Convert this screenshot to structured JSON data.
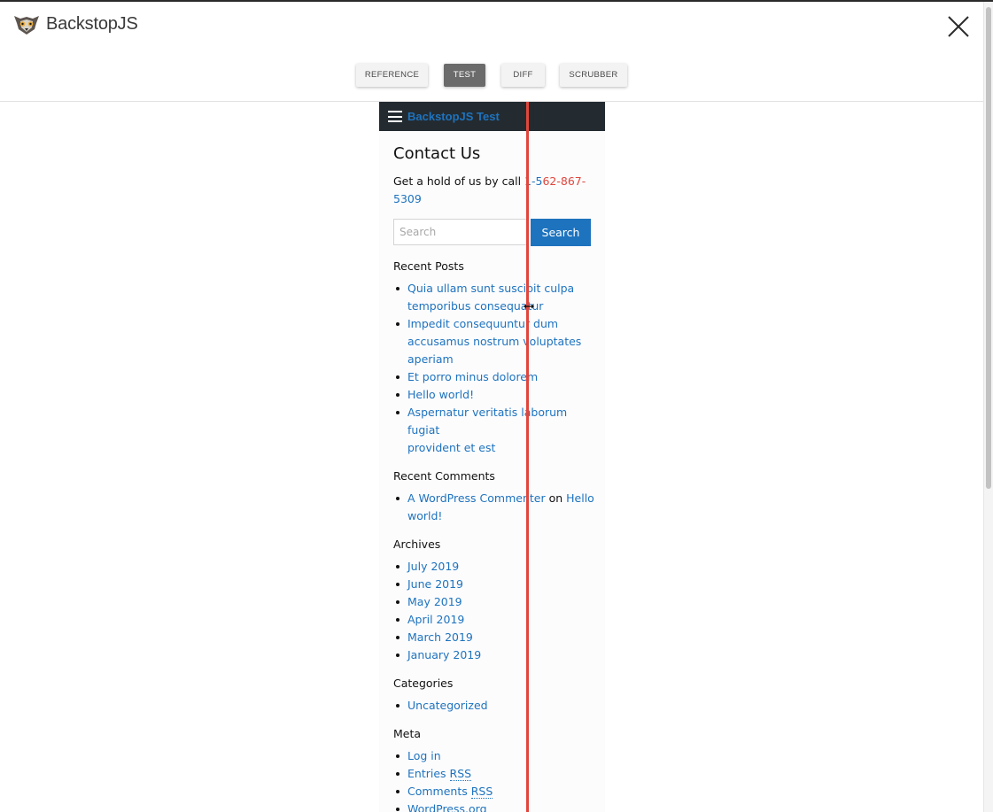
{
  "app": {
    "brand_name": "BackstopJS",
    "close_icon": "close-icon"
  },
  "tabs": [
    {
      "label": "REFERENCE",
      "active": false
    },
    {
      "label": "TEST",
      "active": true
    },
    {
      "label": "DIFF",
      "active": false
    },
    {
      "label": "SCRUBBER",
      "active": false
    }
  ],
  "site": {
    "title": "BackstopJS Test",
    "menu_icon": "hamburger-icon"
  },
  "page": {
    "heading": "Contact Us",
    "intro_text": "Get a hold of us by call ",
    "phone_part1": "1-5",
    "phone_part2": "62-867-",
    "phone_part3": "5309"
  },
  "search": {
    "placeholder": "Search",
    "button_label": "Search"
  },
  "recent_posts": {
    "title": "Recent Posts",
    "items": [
      {
        "line1": "Quia ullam sunt suscipit culpa",
        "line2": "temporibus consequatur"
      },
      {
        "line1": "Impedit consequuntur dum",
        "line2": "accusamus nostrum voluptates",
        "line3": "aperiam"
      },
      {
        "line1": "Et porro minus dolorem"
      },
      {
        "line1": "Hello world!"
      },
      {
        "line1": "Aspernatur veritatis laborum fugiat",
        "line2": "provident et est"
      }
    ]
  },
  "recent_comments": {
    "title": "Recent Comments",
    "author": "A WordPress Commenter",
    "on_text": " on ",
    "post_line1": "Hello",
    "post_line2": "world!"
  },
  "archives": {
    "title": "Archives",
    "items": [
      "July 2019",
      "June 2019",
      "May 2019",
      "April 2019",
      "March 2019",
      "January 2019"
    ]
  },
  "categories": {
    "title": "Categories",
    "items": [
      "Uncategorized"
    ]
  },
  "meta": {
    "title": "Meta",
    "log_in": "Log in",
    "entries_prefix": "Entries ",
    "entries_abbr": "RSS",
    "comments_prefix": "Comments ",
    "comments_abbr": "RSS",
    "wordpress": "WordPress.org"
  },
  "colors": {
    "link": "#1e73be",
    "navbar": "#232b31",
    "scrubber_line": "#e0463c",
    "active_tab": "#6b6b6b"
  }
}
